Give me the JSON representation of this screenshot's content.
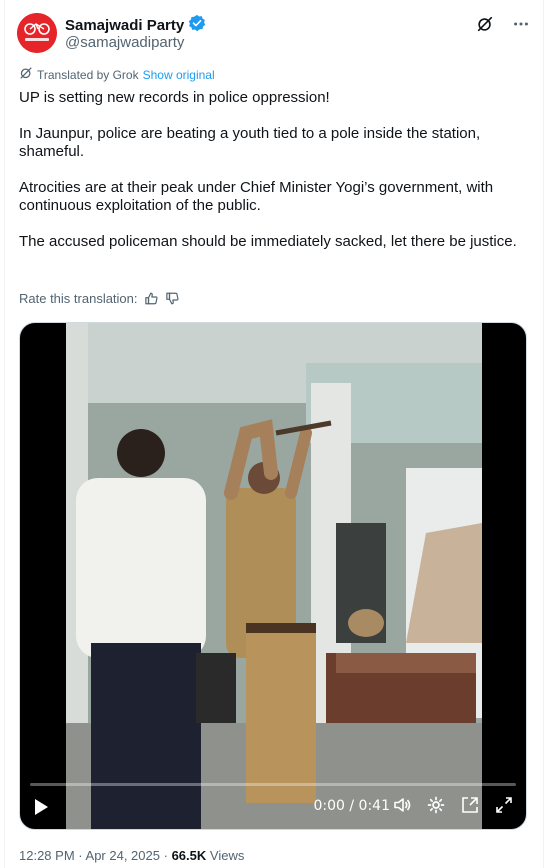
{
  "author": {
    "name": "Samajwadi Party",
    "handle": "@samajwadiparty",
    "verified": true,
    "avatar_text": "समाजवादी पार्टी"
  },
  "translation": {
    "label": "Translated by Grok",
    "show_original": "Show original",
    "rate_label": "Rate this translation:"
  },
  "tweet": {
    "paragraphs": [
      "UP is setting new records in police oppression!",
      "In Jaunpur, police are beating a youth tied to a pole inside the station, shameful.",
      "Atrocities are at their peak under Chief Minister Yogi’s government, with continuous exploitation of the public.",
      "The accused policeman should be immediately sacked, let there be justice."
    ]
  },
  "video": {
    "time": "0:00 / 0:41",
    "progress": 0.0
  },
  "meta": {
    "time": "12:28 PM",
    "separator": "·",
    "date": "Apr 24, 2025",
    "views_count": "66.5K",
    "views_label": "Views"
  },
  "colors": {
    "accent": "#1d9bf0",
    "secondary_text": "#536471",
    "avatar_bg": "#e5252a"
  }
}
